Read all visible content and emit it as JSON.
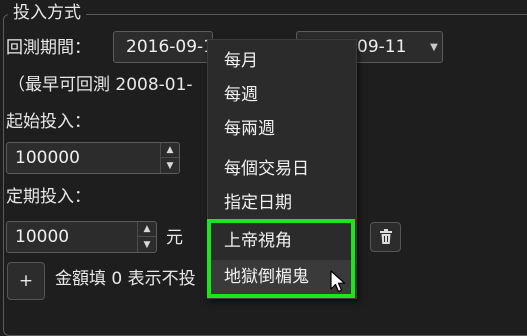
{
  "group": {
    "title": "投入方式"
  },
  "period": {
    "label": "回測期間：",
    "start_date": "2016-09-1",
    "end_date": "09-11",
    "earliest_note": "（最早可回測 2008-01-"
  },
  "initial": {
    "label": "起始投入：",
    "value": "100000"
  },
  "periodic": {
    "label": "定期投入：",
    "value": "10000",
    "unit": "元"
  },
  "add_button": {
    "label": "+"
  },
  "hint": "金額填 0 表示不投",
  "frequency_menu": {
    "items": [
      "每月",
      "每週",
      "每兩週",
      "每個交易日",
      "指定日期",
      "上帝視角",
      "地獄倒楣鬼"
    ],
    "hovered_index": 6
  },
  "highlight_color": "#1de51d",
  "icons": {
    "combo_arrow": "chevron-down-icon",
    "spin_up": "arrow-up-icon",
    "spin_down": "arrow-down-icon",
    "delete": "trash-icon",
    "cursor": "mouse-pointer-icon"
  }
}
